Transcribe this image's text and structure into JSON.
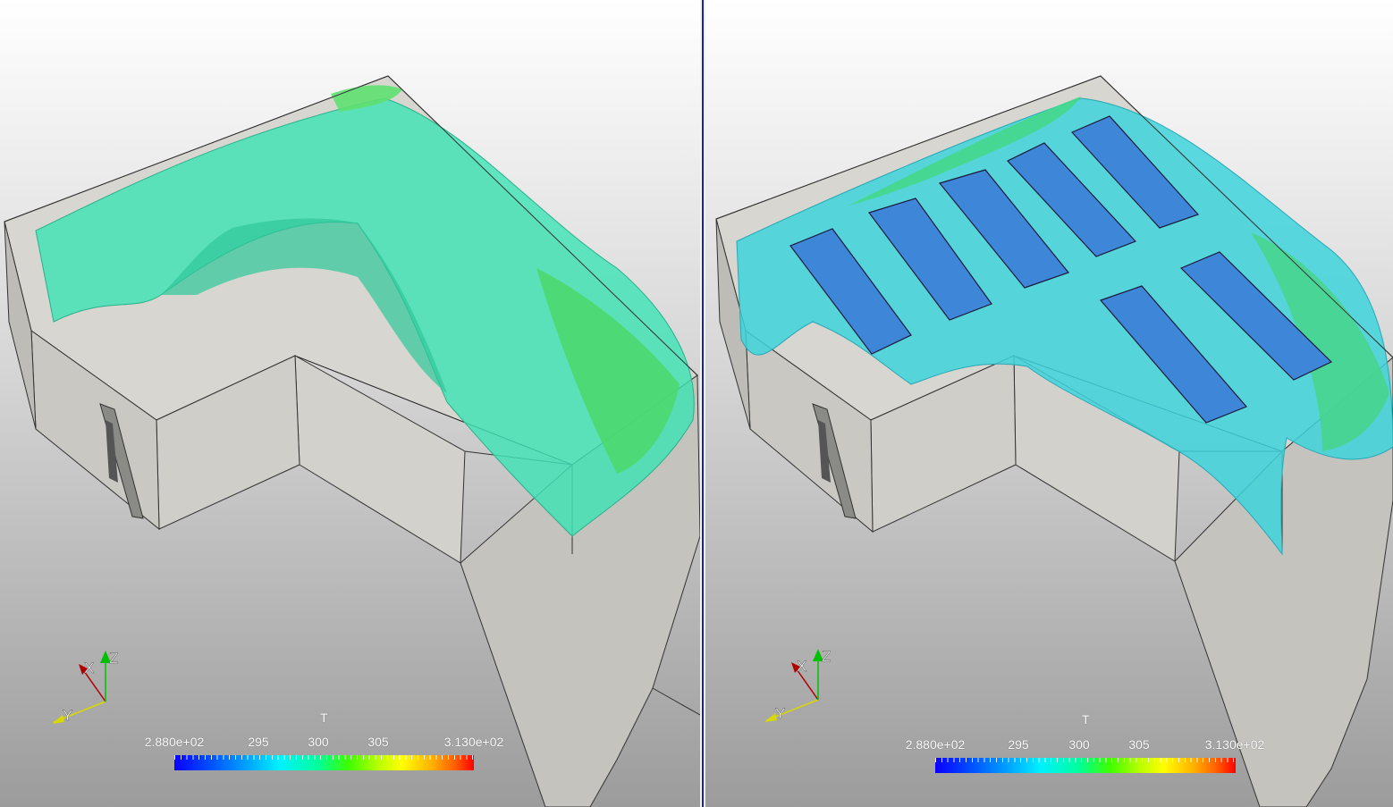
{
  "views": [
    {
      "id": "left",
      "colorbar": {
        "title": "T",
        "ticks": [
          "2.880e+02",
          "295",
          "300",
          "305",
          "3.130e+02"
        ],
        "tick_values": [
          288,
          295,
          300,
          305,
          313
        ],
        "range": [
          288,
          313
        ]
      },
      "axes": {
        "x": "X",
        "y": "Y",
        "z": "Z"
      }
    },
    {
      "id": "right",
      "colorbar": {
        "title": "T",
        "ticks": [
          "2.880e+02",
          "295",
          "300",
          "305",
          "3.130e+02"
        ],
        "tick_values": [
          288,
          295,
          300,
          305,
          313
        ],
        "range": [
          288,
          313
        ]
      },
      "axes": {
        "x": "X",
        "y": "Y",
        "z": "Z"
      }
    }
  ],
  "colors": {
    "separator": "#1c23a0",
    "isosurface_left": "#3fe3b4",
    "isosurface_right": "#3ed3dc",
    "panels": "#3e86d8",
    "axis_x": "#b00000",
    "axis_y": "#d8d800",
    "axis_z": "#00c000"
  }
}
